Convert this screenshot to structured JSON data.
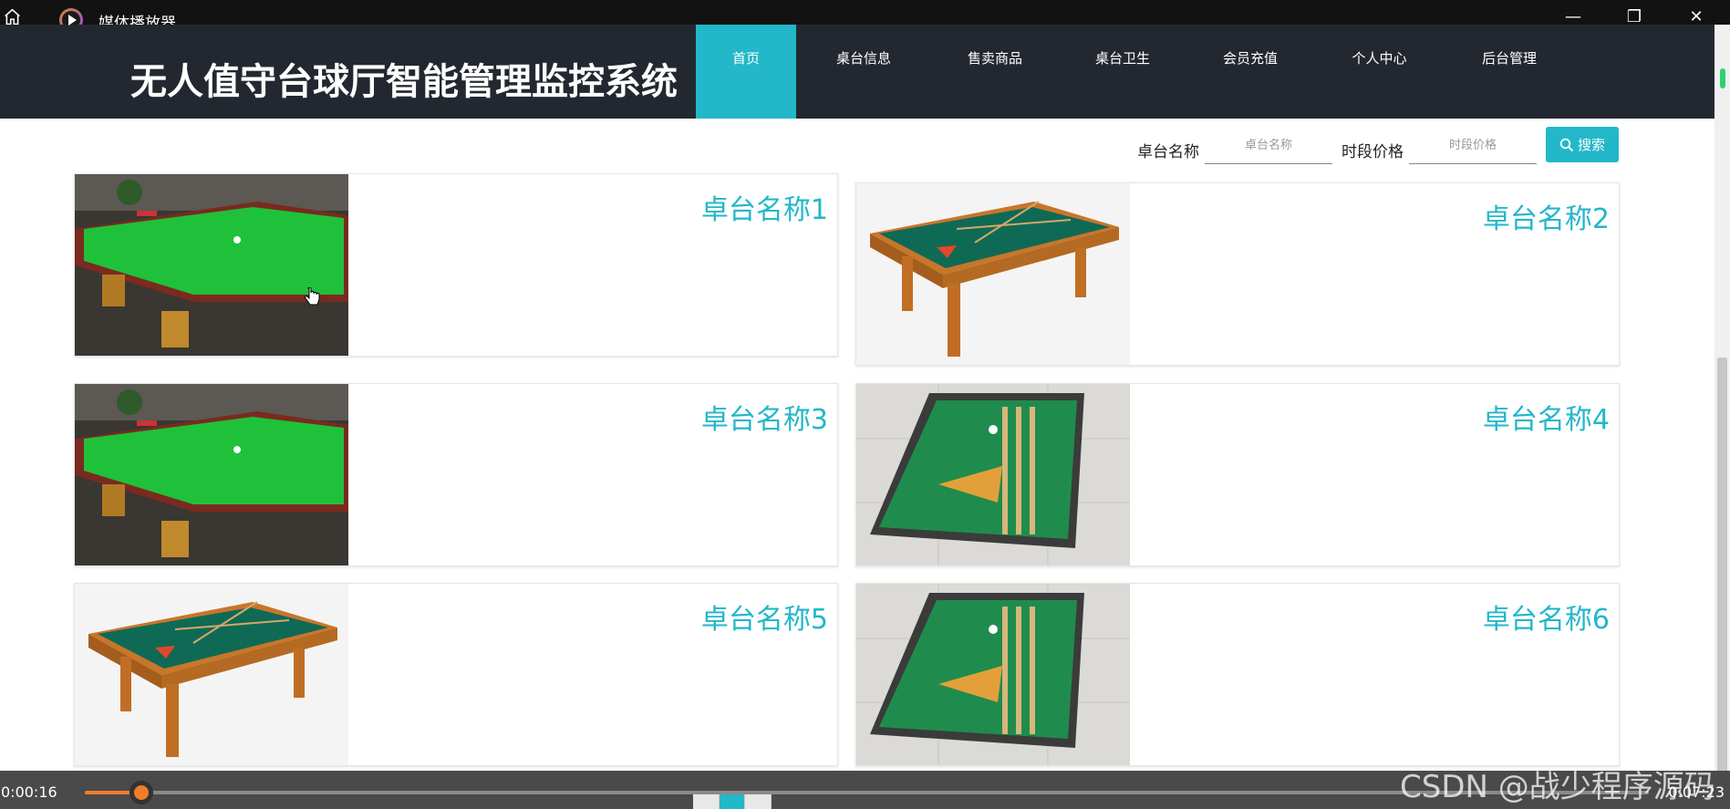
{
  "player": {
    "title": "媒体播放器",
    "time_current": "0:00:16",
    "time_total": "0:07:23",
    "progress_fraction": 0.036,
    "accent": "#f07d2b"
  },
  "site": {
    "title": "无人值守台球厅智能管理监控系统",
    "accent": "#22b7c9",
    "nav": [
      {
        "label": "首页",
        "active": true
      },
      {
        "label": "桌台信息",
        "active": false
      },
      {
        "label": "售卖商品",
        "active": false
      },
      {
        "label": "桌台卫生",
        "active": false
      },
      {
        "label": "会员充值",
        "active": false
      },
      {
        "label": "个人中心",
        "active": false
      },
      {
        "label": "后台管理",
        "active": false
      }
    ]
  },
  "search": {
    "name_label": "卓台名称",
    "name_placeholder": "卓台名称",
    "price_label": "时段价格",
    "price_placeholder": "时段价格",
    "button_label": "搜索",
    "button_icon": "search-icon"
  },
  "tables": [
    {
      "name": "卓台名称1",
      "image": "snooker-table-room"
    },
    {
      "name": "卓台名称2",
      "image": "pool-table-white"
    },
    {
      "name": "卓台名称3",
      "image": "snooker-table-room"
    },
    {
      "name": "卓台名称4",
      "image": "pool-table-tiles"
    },
    {
      "name": "卓台名称5",
      "image": "pool-table-white"
    },
    {
      "name": "卓台名称6",
      "image": "pool-table-tiles"
    }
  ],
  "watermark": "CSDN @战少程序源码"
}
